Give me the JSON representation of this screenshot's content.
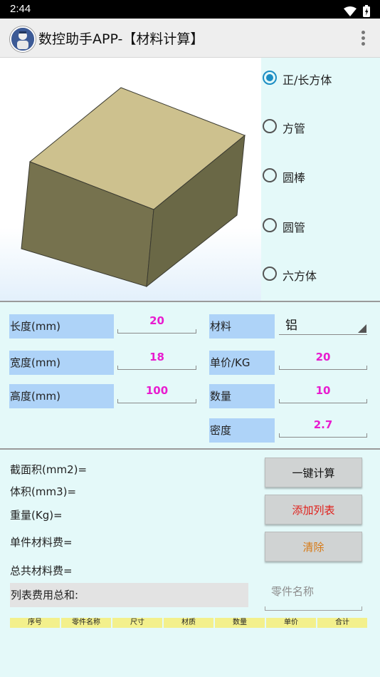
{
  "status": {
    "time": "2:44"
  },
  "appbar": {
    "title": "数控助手APP-【材料计算】"
  },
  "shapes": [
    {
      "label": "正/长方体",
      "checked": true
    },
    {
      "label": "方管",
      "checked": false
    },
    {
      "label": "圆棒",
      "checked": false
    },
    {
      "label": "圆管",
      "checked": false
    },
    {
      "label": "六方体",
      "checked": false
    }
  ],
  "inputs": {
    "length": {
      "label": "长度(mm)",
      "value": "20"
    },
    "width": {
      "label": "宽度(mm)",
      "value": "18"
    },
    "height": {
      "label": "高度(mm)",
      "value": "100"
    },
    "material": {
      "label": "材料",
      "value": "铝"
    },
    "unit_price": {
      "label": "单价/KG",
      "value": "20"
    },
    "quantity": {
      "label": "数量",
      "value": "10"
    },
    "density": {
      "label": "密度",
      "value": "2.7"
    }
  },
  "results": {
    "area": "截面积(mm2)=",
    "volume": "体积(mm3)=",
    "weight": "重量(Kg)=",
    "unit_cost": "单件材料费=",
    "total_cost": "总共材料费=",
    "list_total": "列表费用总和:"
  },
  "buttons": {
    "calc": "一键计算",
    "add": "添加列表",
    "clear": "清除"
  },
  "colors": {
    "calc": "#111111",
    "add": "#e0201b",
    "clear": "#d77a16"
  },
  "part_name": {
    "placeholder": "零件名称",
    "value": ""
  },
  "table": {
    "headers": [
      "序号",
      "零件名称",
      "尺寸",
      "材质",
      "数量",
      "单价",
      "合计"
    ]
  }
}
